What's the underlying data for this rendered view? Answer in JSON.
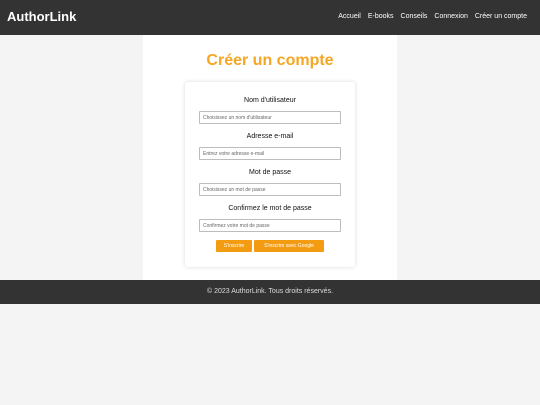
{
  "header": {
    "brand": "AuthorLink",
    "nav": [
      "Accueil",
      "E-books",
      "Conseils",
      "Connexion",
      "Créer un compte"
    ]
  },
  "main": {
    "title": "Créer un compte",
    "form": {
      "username_label": "Nom d'utilisateur",
      "username_placeholder": "Choisissez un nom d'utilisateur",
      "email_label": "Adresse e-mail",
      "email_placeholder": "Entrez votre adresse e-mail",
      "password_label": "Mot de passe",
      "password_placeholder": "Choisissez un mot de passe",
      "confirm_label": "Confirmez le mot de passe",
      "confirm_placeholder": "Confirmez votre mot de passe",
      "submit_label": "S'inscrire",
      "google_label": "S'inscrire avec Google"
    }
  },
  "footer": {
    "text": "© 2023 AuthorLink. Tous droits réservés."
  },
  "colors": {
    "accent": "#f39c12",
    "title": "#f5a623",
    "header_bg": "#333333"
  }
}
